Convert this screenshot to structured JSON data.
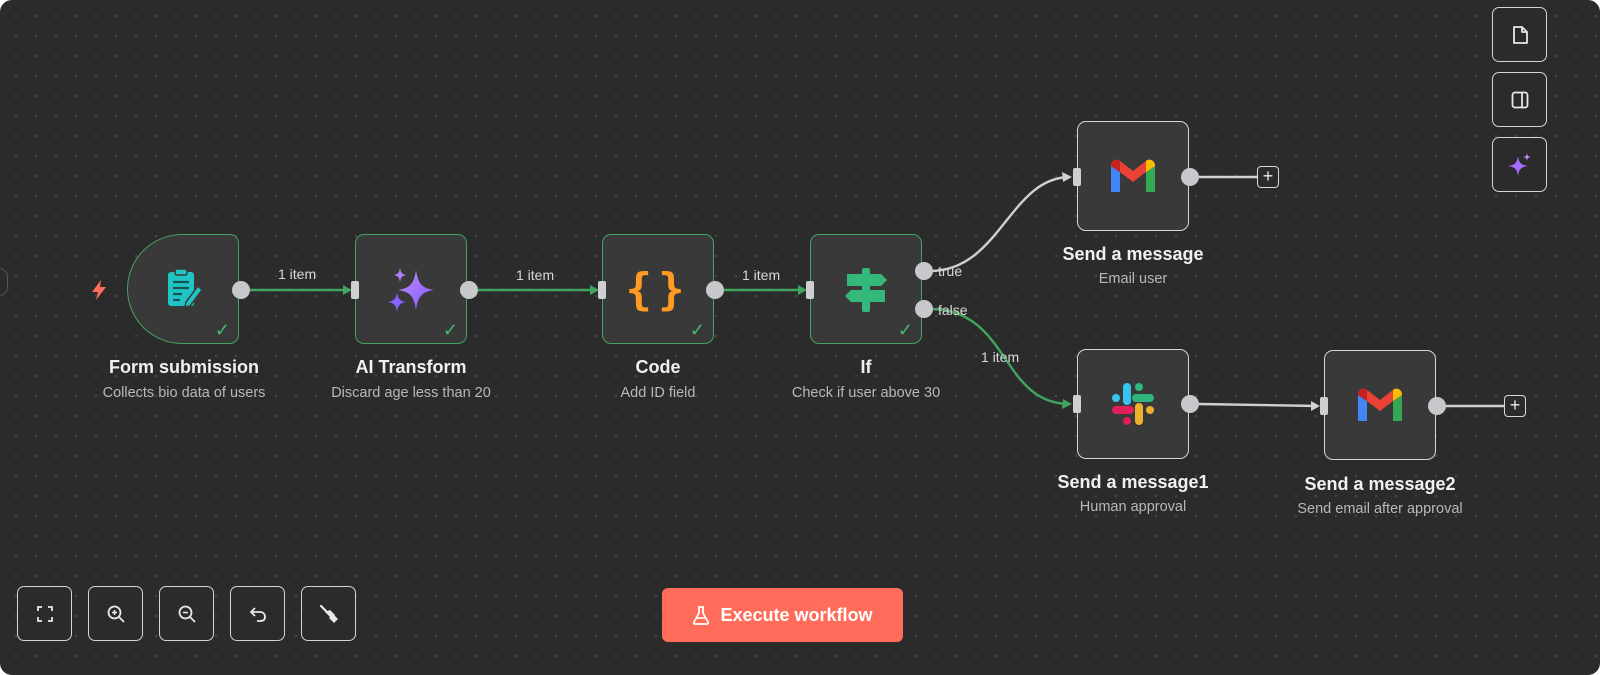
{
  "nodes": {
    "form": {
      "title": "Form submission",
      "subtitle": "Collects bio data of users",
      "icon": "form-icon",
      "status": "success"
    },
    "ai": {
      "title": "AI Transform",
      "subtitle": "Discard age less than 20",
      "icon": "ai-sparkle-icon",
      "status": "success"
    },
    "code": {
      "title": "Code",
      "subtitle": "Add ID field",
      "icon": "braces-icon",
      "status": "success"
    },
    "if": {
      "title": "If",
      "subtitle": "Check if user above 30",
      "icon": "signpost-icon",
      "status": "success"
    },
    "gmail1": {
      "title": "Send a message",
      "subtitle": "Email user",
      "icon": "gmail-icon"
    },
    "slack": {
      "title": "Send a message1",
      "subtitle": "Human approval",
      "icon": "slack-icon"
    },
    "gmail2": {
      "title": "Send a message2",
      "subtitle": "Send email after approval",
      "icon": "gmail-icon"
    }
  },
  "edges": {
    "form_to_ai": "1 item",
    "ai_to_code": "1 item",
    "code_to_if": "1 item",
    "if_false_to_slack": "1 item"
  },
  "branches": {
    "true_label": "true",
    "false_label": "false"
  },
  "right_toolbar": [
    "sticky-note-icon",
    "side-panel-icon",
    "ai-assistant-icon"
  ],
  "bottom_toolbar": [
    "fit-view-icon",
    "zoom-in-icon",
    "zoom-out-icon",
    "undo-icon",
    "clean-up-icon"
  ],
  "execute_button": {
    "label": "Execute workflow",
    "icon": "flask-icon"
  },
  "colors": {
    "canvas": "#2b2b2b",
    "success": "#3fa55f",
    "accent": "#ff6d5a",
    "ai_purple": "#a66cff"
  }
}
